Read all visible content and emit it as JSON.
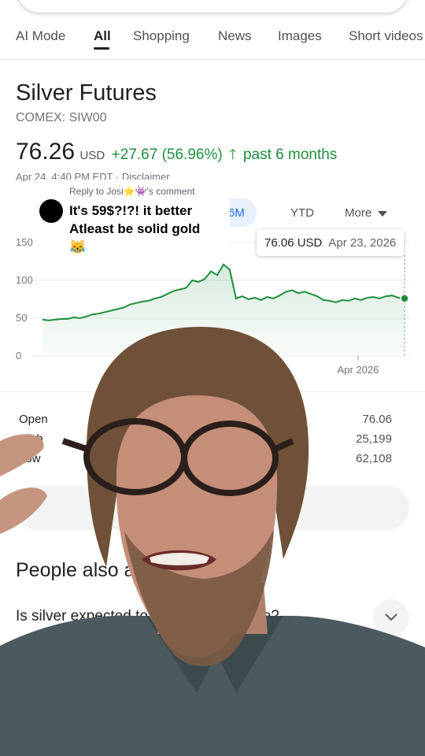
{
  "tabs": [
    {
      "label": "AI Mode"
    },
    {
      "label": "All"
    },
    {
      "label": "Shopping"
    },
    {
      "label": "News"
    },
    {
      "label": "Images"
    },
    {
      "label": "Short videos"
    }
  ],
  "instrument": {
    "title": "Silver Futures",
    "exchange": "COMEX: SIW00",
    "price": "76.26",
    "currency": "USD",
    "change": "+27.67 (56.96%)",
    "period": "past 6 months",
    "timestamp": "Apr 24, 4:40 PM EDT · Disclaimer"
  },
  "ranges": {
    "six_month": "6M",
    "ytd": "YTD",
    "more": "More"
  },
  "tooltip": {
    "value": "76.06 USD",
    "date": "Apr 23, 2026"
  },
  "chart_data": {
    "type": "area",
    "yticks": [
      "150",
      "100",
      "50",
      "0"
    ],
    "ylim": [
      0,
      150
    ],
    "xtick_label": "Apr 2026",
    "grid": true,
    "color": "#1e8e3e",
    "series": [
      {
        "values": [
          48,
          47,
          48,
          49,
          49,
          51,
          50,
          52,
          55,
          56,
          58,
          60,
          62,
          64,
          68,
          70,
          72,
          73,
          76,
          78,
          82,
          86,
          88,
          90,
          100,
          98,
          102,
          112,
          107,
          121,
          114,
          76,
          79,
          75,
          77,
          74,
          78,
          76,
          80,
          85,
          87,
          83,
          85,
          82,
          79,
          74,
          73,
          71,
          74,
          73,
          76,
          74,
          77,
          78,
          76,
          79,
          80,
          77,
          76
        ]
      }
    ]
  },
  "stats": [
    {
      "label": "Open",
      "value": "76.06"
    },
    {
      "label": "High",
      "value": "25,199"
    },
    {
      "label": "Low",
      "value": "62,108"
    }
  ],
  "people_also_ask": {
    "heading": "People also ask",
    "question": "Is silver expected to hit $100 an ounce?"
  },
  "reply_sticker": {
    "header": "Reply to Josi⭐👾's comment",
    "text": "It's 59$?!?! it better Atleast be solid gold",
    "emoji": "😹"
  },
  "colors": {
    "accent": "#1a73e8",
    "positive": "#1e8e3e"
  }
}
